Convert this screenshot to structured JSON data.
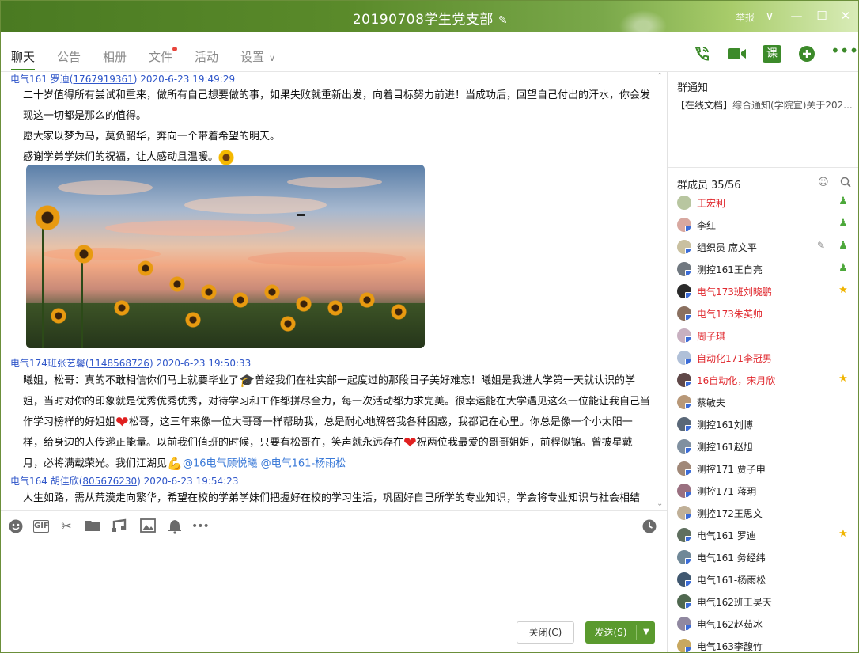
{
  "window": {
    "title": "20190708学生党支部",
    "report": "举报",
    "colors": {
      "accent": "#3d8a1e",
      "send": "#5a9a2e",
      "titlebar": "#4a7a22"
    }
  },
  "tabs": [
    {
      "label": "聊天",
      "active": true
    },
    {
      "label": "公告"
    },
    {
      "label": "相册"
    },
    {
      "label": "文件",
      "dot": true
    },
    {
      "label": "活动"
    },
    {
      "label": "设置"
    }
  ],
  "toolbar_icons": [
    "phone-call-icon",
    "video-call-icon",
    "class-icon",
    "add-app-icon",
    "more-icon"
  ],
  "class_label": "课",
  "messages": [
    {
      "sender": "电气161 罗迪",
      "qq": "1767919361",
      "time": "2020-6-23 19:49:29",
      "lines": [
        "二十岁值得所有尝试和重来，做所有自己想要做的事，如果失败就重新出发，向着目标努力前进！当成功后，回望自己付出的汗水，你会发",
        "现这一切都是那么的值得。",
        "愿大家以梦为马，莫负韶华，奔向一个带着希望的明天。",
        "感谢学弟学妹们的祝福，让人感动且温暖。"
      ]
    },
    {
      "sender": "电气174班张艺馨",
      "qq": "1148568726",
      "time": "2020-6-23 19:50:33",
      "l1a": "曦姐，松哥：真的不敢相信你们马上就要毕业了",
      "l1b": "曾经我们在社实部一起度过的那段日子美好难忘！曦姐是我进大学第一天就认识的学",
      "l2": "姐，当时对你的印象就是优秀优秀优秀，对待学习和工作都拼尽全力，每一次活动都力求完美。很幸运能在大学遇见这么一位能让我自己当",
      "l3a": "作学习榜样的好姐姐",
      "l3b": "松哥，这三年来像一位大哥哥一样帮助我，总是耐心地解答我各种困惑，我都记在心里。你总是像一个小太阳一",
      "l4a": "样，给身边的人传递正能量。以前我们值班的时候，只要有松哥在，笑声就永远存在",
      "l4b": "祝两位我最爱的哥哥姐姐，前程似锦。曾披星戴",
      "l5a": "月，必将满载荣光。我们江湖见",
      "mention1": "@16电气顾悦曦",
      "mention2": "@电气161-杨雨松"
    },
    {
      "sender": "电气164 胡佳欣",
      "qq": "805676230",
      "time": "2020-6-23 19:54:23",
      "line": "人生如路，需从荒漠走向繁华，希望在校的学弟学妹们把握好在校的学习生活，巩固好自己所学的专业知识，学会将专业知识与社会相结"
    }
  ],
  "input_icons": [
    "emoji-icon",
    "gif-icon",
    "scissors-icon",
    "folder-icon",
    "music-icon",
    "image-icon",
    "bell-icon",
    "more-icon"
  ],
  "gif_label": "GIF",
  "buttons": {
    "close": "关闭(C)",
    "send": "发送(S)"
  },
  "notice": {
    "title": "群通知",
    "tag": "【在线文档】",
    "text": "综合通知(学院宣)关于202..."
  },
  "members": {
    "title": "群成员",
    "count": "35/56",
    "list": [
      {
        "name": "王宏利",
        "red": true,
        "badge": "admin"
      },
      {
        "name": "李红",
        "badge": "admin"
      },
      {
        "name": "组织员 席文平",
        "badge": "admin",
        "edit": true
      },
      {
        "name": "测控161王自亮",
        "badge": "admin"
      },
      {
        "name": "电气173班刘晓鹏",
        "red": true,
        "badge": "star"
      },
      {
        "name": "电气173朱英帅",
        "red": true
      },
      {
        "name": "周子琪",
        "red": true
      },
      {
        "name": "自动化171李冠男",
        "red": true
      },
      {
        "name": "16自动化，宋月欣",
        "red": true,
        "badge": "star"
      },
      {
        "name": "蔡敏夫"
      },
      {
        "name": "测控161刘博"
      },
      {
        "name": "测控161赵旭"
      },
      {
        "name": "测控171 贾子申"
      },
      {
        "name": "测控171-蒋玥"
      },
      {
        "name": "测控172王思文"
      },
      {
        "name": "电气161 罗迪",
        "badge": "star"
      },
      {
        "name": "电气161 务经纬"
      },
      {
        "name": "电气161-杨雨松"
      },
      {
        "name": "电气162班王昊天"
      },
      {
        "name": "电气162赵茹冰"
      },
      {
        "name": "电气163李馥竹"
      }
    ]
  }
}
